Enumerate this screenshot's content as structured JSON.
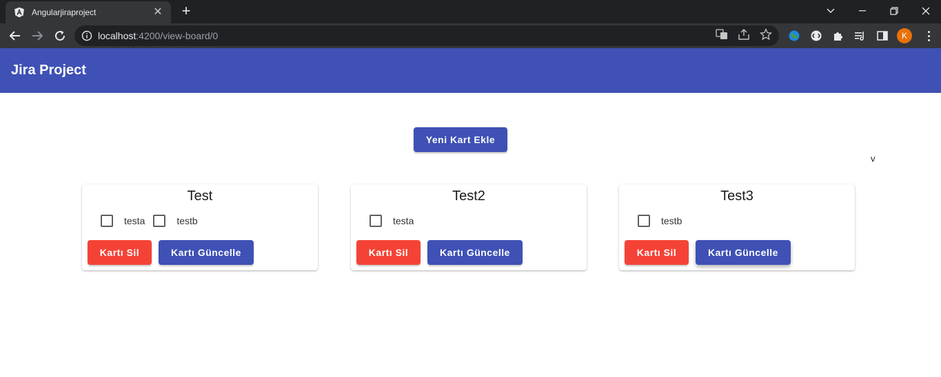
{
  "browser": {
    "tab_title": "Angularjiraproject",
    "url_host": "localhost",
    "url_rest": ":4200/view-board/0",
    "profile_initial": "K"
  },
  "app": {
    "title": "Jira Project",
    "add_card_label": "Yeni Kart Ekle",
    "stray_text": "v",
    "primary_color": "#3f51b5",
    "warn_color": "#f44336"
  },
  "cards": [
    {
      "title": "Test",
      "items": [
        "testa",
        "testb"
      ],
      "delete_label": "Kartı Sil",
      "update_label": "Kartı Güncelle"
    },
    {
      "title": "Test2",
      "items": [
        "testa"
      ],
      "delete_label": "Kartı Sil",
      "update_label": "Kartı Güncelle"
    },
    {
      "title": "Test3",
      "items": [
        "testb"
      ],
      "delete_label": "Kartı Sil",
      "update_label": "Kartı Güncelle"
    }
  ]
}
